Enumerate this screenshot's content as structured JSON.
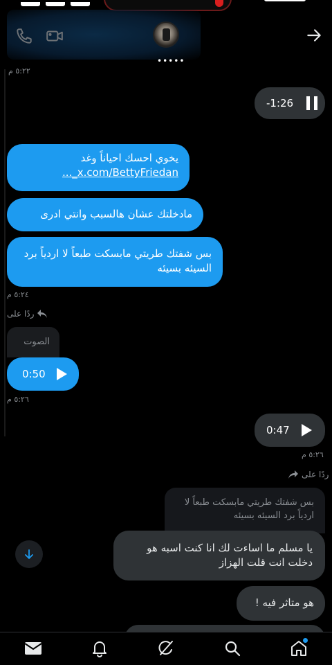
{
  "header": {
    "top_timestamp": "٥:٢٢ م",
    "more_label": "•••••"
  },
  "messages": {
    "audio_sent_1": {
      "time": "-1:26",
      "state": "pause"
    },
    "msg_link": {
      "text": "يخوي احسك احياناً وغد",
      "link": "x.com/BettyFriedan_..."
    },
    "msg_2": "مادخلتك عشان هالسبب وانتي ادرى",
    "msg_3": "بس شفتك طريتي مابسكت طبعاً لا اردياً برد السيئه بسيئه",
    "ts_1": "٥:٢٤ م",
    "reply_label_1": "ردًا على",
    "reply_quote_1": "الصوت",
    "audio_received": {
      "time": "0:50",
      "state": "play"
    },
    "ts_2": "٥:٢٦ م",
    "audio_sent_2": {
      "time": "0:47",
      "state": "play"
    },
    "ts_3": "٥:٢٦ م",
    "reply_label_2": "ردًا على",
    "reply_quote_2": "بس شفتك طريتي مابسكت طبعاً لا اردياً برد السيئه بسيئه",
    "msg_4": "يا مسلم ما اساءت لك انا كنت اسبه هو دخلت انت قلت الهزاز",
    "msg_5": "هو متاثر فيه !"
  },
  "colors": {
    "accent": "#1d9bf0",
    "bubble_gray": "#2f3336",
    "background": "#000000"
  },
  "icons": {
    "phone": "phone-icon",
    "video": "video-icon",
    "back": "arrow-right-icon",
    "scroll": "arrow-down-icon",
    "nav": [
      "mail-icon",
      "bell-icon",
      "grok-icon",
      "search-icon",
      "home-icon"
    ]
  }
}
